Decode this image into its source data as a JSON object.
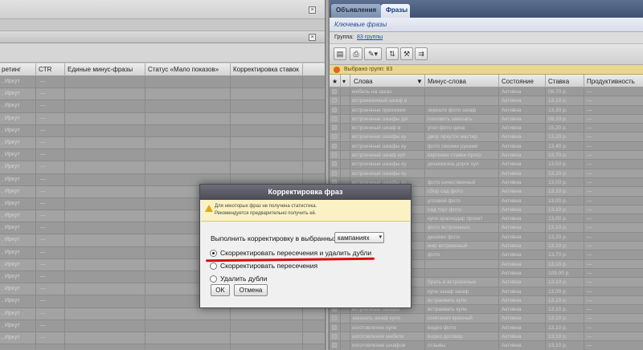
{
  "left_pane": {
    "columns": [
      "ретинг",
      "CTR",
      "Единые минус-фразы",
      "Статус «Мало показов»",
      "Корректировка ставок"
    ],
    "row_region": ", Иркут",
    "row_empty": "—",
    "row_count": 22
  },
  "right_pane": {
    "tabs": [
      "Объявления",
      "Фразы"
    ],
    "active_tab": "Фразы",
    "keywords_title": "Ключевые фразы",
    "group_label": "Группа:",
    "group_count": "83 группы",
    "selected_text": "Выбрано групп: 83",
    "columns": [
      "Слова",
      "Минус-слова",
      "Состояние",
      "Ставка",
      "Продуктивность"
    ],
    "rows": [
      {
        "words": "мебель на заказ",
        "minus": "",
        "state": "Активна",
        "bid": "08,70 р.",
        "prod": "—"
      },
      {
        "words": "встраиваемый шкаф в",
        "minus": "",
        "state": "Активна",
        "bid": "13,10 р.",
        "prod": "—"
      },
      {
        "words": "встроенные прихожие",
        "minus": "зеркало фото шкаф",
        "state": "Активна",
        "bid": "13,30 р.",
        "prod": "—"
      },
      {
        "words": "встроенные шкафы дл",
        "minus": "поновить заказать",
        "state": "Активна",
        "bid": "08,20 р.",
        "prod": "—"
      },
      {
        "words": "встроенный шкаф в",
        "minus": "угол фото цена",
        "state": "Активна",
        "bid": "15,20 р.",
        "prod": "—"
      },
      {
        "words": "встроенные шкафы ку",
        "minus": "двор иркутск мастер",
        "state": "Активна",
        "bid": "13,20 р.",
        "prod": "—"
      },
      {
        "words": "встроенные шкафы ку",
        "minus": "фото своими руками",
        "state": "Активна",
        "bid": "13,40 р.",
        "prod": "—"
      },
      {
        "words": "встроенный шкаф куп",
        "minus": "картинки ставки прогр",
        "state": "Активна",
        "bid": "13,70 р.",
        "prod": "—"
      },
      {
        "words": "встроенные шкафы ку",
        "minus": "дешевизна дорог куп",
        "state": "Активна",
        "bid": "13,50 р.",
        "prod": "—"
      },
      {
        "words": "встроенные шкафы ку",
        "minus": "",
        "state": "Активна",
        "bid": "13,20 р.",
        "prod": "—"
      },
      {
        "words": "встроенные шкафы ку",
        "minus": "фото качественный",
        "state": "Активна",
        "bid": "13,00 р.",
        "prod": "—"
      },
      {
        "words": "встроенные шкафы ку",
        "minus": "сбор сад фото",
        "state": "Активна",
        "bid": "13,10 р.",
        "prod": "—"
      },
      {
        "words": "встраиваемые шкафы",
        "minus": "угловой фото",
        "state": "Активна",
        "bid": "13,00 р.",
        "prod": "—"
      },
      {
        "words": "встроенные шкафы",
        "minus": "сад торг фото",
        "state": "Активна",
        "bid": "13,10 р.",
        "prod": "—"
      },
      {
        "words": "встроенные шкафы ку",
        "minus": "купе краснодар проект",
        "state": "Активна",
        "bid": "13,00 р.",
        "prod": "—"
      },
      {
        "words": "встроенные шкафы",
        "minus": "фото встроенных",
        "state": "Активна",
        "bid": "13,10 р.",
        "prod": "—"
      },
      {
        "words": "встроенные шкафы ку",
        "minus": "дешево фото",
        "state": "Активна",
        "bid": "13,20 р.",
        "prod": "—"
      },
      {
        "words": "встроенный шкаф",
        "minus": "мир встроенный",
        "state": "Активна",
        "bid": "13,10 р.",
        "prod": "—"
      },
      {
        "words": "встроенный шкаф",
        "minus": "фото",
        "state": "Активна",
        "bid": "13,70 р.",
        "prod": "—"
      },
      {
        "words": "встроенные шкафы",
        "minus": "",
        "state": "Активна",
        "bid": "13,10 р.",
        "prod": "—"
      },
      {
        "words": "встроенные шкафы",
        "minus": "",
        "state": "Активна",
        "bid": "109,00 р.",
        "prod": "—"
      },
      {
        "words": "встроенные шкафы ку",
        "minus": "брать в встроенные",
        "state": "Активна",
        "bid": "13,10 р.",
        "prod": "—"
      },
      {
        "words": "встраиваемые шкафы",
        "minus": "купе шкаф шкаф",
        "state": "Активна",
        "bid": "13,00 р.",
        "prod": "—"
      },
      {
        "words": "встроенные шкафы ку",
        "minus": "встраивать купе",
        "state": "Активна",
        "bid": "13,10 р.",
        "prod": "—"
      },
      {
        "words": "встроенные шкафы",
        "minus": "встраивать купе",
        "state": "Активна",
        "bid": "13,10 р.",
        "prod": "—"
      },
      {
        "words": "заказать шкаф купе",
        "minus": "компания красный",
        "state": "Активна",
        "bid": "13,10 р.",
        "prod": "—"
      },
      {
        "words": "изготовление купе",
        "minus": "видео фото",
        "state": "Активна",
        "bid": "13,10 р.",
        "prod": "—"
      },
      {
        "words": "изготовление мебели",
        "minus": "видео договор",
        "state": "Активна",
        "bid": "13,10 р.",
        "prod": "—"
      },
      {
        "words": "изготовление шкафов",
        "minus": "отзывы",
        "state": "Активна",
        "bid": "13,10 р.",
        "prod": "—"
      }
    ]
  },
  "dialog": {
    "title": "Корректировка фраз",
    "warning_line1": "Для некоторых фраз не получена статистика.",
    "warning_line2": "Рекомендуется предварительно получить её.",
    "apply_label": "Выполнить корректировку в выбранных",
    "select_value": "кампаниях",
    "options": [
      {
        "label": "Скорректировать пересечения и удалить дубли",
        "checked": true
      },
      {
        "label": "Скорректировать пересечения",
        "checked": false
      },
      {
        "label": "Удалить дубли",
        "checked": false
      }
    ],
    "ok_label": "OK",
    "cancel_label": "Отмена"
  },
  "colors": {
    "dialog_title_bg": "#55555f",
    "warning_bg": "#faf2c2",
    "tab_active_text": "#173a78",
    "annotation_red": "#d60f0f",
    "selection_bar": "#e9d78e"
  },
  "icons": {
    "close": "close-icon",
    "trash": "trash-icon",
    "warning": "warning-icon",
    "selection": "selection-info-icon"
  }
}
